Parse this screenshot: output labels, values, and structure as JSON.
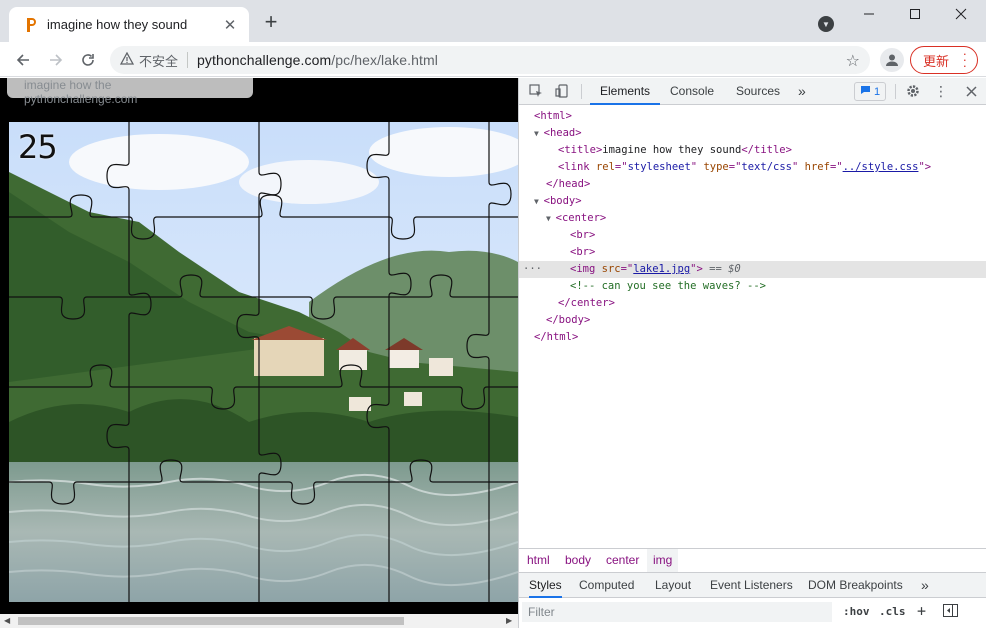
{
  "tab": {
    "title": "imagine how they sound",
    "close": "✕"
  },
  "new_tab": "+",
  "window": {
    "minimize": "—",
    "maximize": "☐",
    "close": "✕"
  },
  "toolbar": {
    "insecure_label": "不安全",
    "url_host": "pythonchallenge.com",
    "url_path": "/pc/hex/lake.html",
    "update_label": "更新"
  },
  "hover_card": {
    "title": "imagine how the",
    "domain": "pythonchallenge.com"
  },
  "page": {
    "puzzle_number": "25"
  },
  "devtools": {
    "tabs": [
      "Elements",
      "Console",
      "Sources"
    ],
    "more": "»",
    "issues_count": "1",
    "dom": {
      "html_open": "html",
      "head_open": "head",
      "title_tag": "title",
      "title_text": "imagine how they sound",
      "link_tag": "link",
      "rel_attr": "rel",
      "rel_val": "stylesheet",
      "type_attr": "type",
      "type_val": "text/css",
      "href_attr": "href",
      "href_val": "../style.css",
      "head_close": "/head",
      "body_open": "body",
      "center_open": "center",
      "br": "br",
      "img_tag": "img",
      "src_attr": "src",
      "src_val": "lake1.jpg",
      "eq_ref": " == $0",
      "comment": "<!-- can you see the waves? -->",
      "center_close": "/center",
      "body_close": "/body",
      "html_close": "/html"
    },
    "breadcrumbs": [
      "html",
      "body",
      "center",
      "img"
    ],
    "style_tabs": [
      "Styles",
      "Computed",
      "Layout",
      "Event Listeners",
      "DOM Breakpoints"
    ],
    "style_more": "»",
    "filter_placeholder": "Filter",
    "hov": ":hov",
    "cls": ".cls",
    "plus": "+"
  },
  "colors": {
    "accent": "#1a73e8",
    "update_red": "#d93025",
    "tag_purple": "#881280",
    "attr_brown": "#994500",
    "value_blue": "#1a1aa6",
    "comment_green": "#236e25"
  }
}
